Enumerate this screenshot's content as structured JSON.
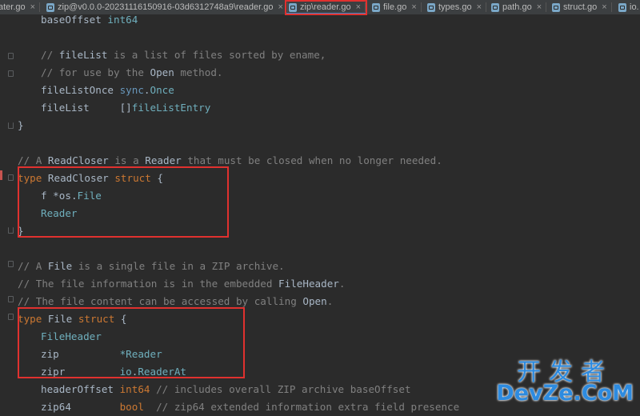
{
  "tabs": [
    {
      "label": "ater.go",
      "icon": "go-file-icon",
      "active": false
    },
    {
      "label": "zip@v0.0.0-20231116150916-03d6312748a9\\reader.go",
      "icon": "go-file-icon",
      "active": false
    },
    {
      "label": "zip\\reader.go",
      "icon": "go-file-icon",
      "active": true
    },
    {
      "label": "file.go",
      "icon": "go-file-icon",
      "active": false
    },
    {
      "label": "types.go",
      "icon": "go-file-icon",
      "active": false
    },
    {
      "label": "path.go",
      "icon": "go-file-icon",
      "active": false
    },
    {
      "label": "struct.go",
      "icon": "go-file-icon",
      "active": false
    },
    {
      "label": "io.",
      "icon": "go-file-icon",
      "active": false
    }
  ],
  "close_glyph": "×",
  "code": {
    "l1": {
      "a": "baseOffset",
      "b": "int64"
    },
    "l3": {
      "a": "// ",
      "b": "fileList",
      "c": " is a list of files sorted by ename,"
    },
    "l4": {
      "a": "// for use by the ",
      "b": "Open",
      "c": " method."
    },
    "l5": {
      "a": "fileListOnce ",
      "b": "sync",
      "c": ".",
      "d": "Once"
    },
    "l6": {
      "a": "fileList     ",
      "b": "[]",
      "c": "fileListEntry"
    },
    "l7": {
      "a": "}"
    },
    "l9": {
      "a": "// A ",
      "b": "ReadCloser",
      "c": " is a ",
      "d": "Reader",
      "e": " that must be closed when no longer needed."
    },
    "l10": {
      "a": "type",
      "b": " ReadCloser ",
      "c": "struct",
      "d": " {"
    },
    "l11": {
      "a": "f ",
      "b": "*",
      "c": "os",
      "d": ".",
      "e": "File"
    },
    "l12": {
      "a": "Reader"
    },
    "l13": {
      "a": "}"
    },
    "l15": {
      "a": "// A ",
      "b": "File",
      "c": " is a single file in a ZIP archive."
    },
    "l16": {
      "a": "// The file information is in the embedded ",
      "b": "FileHeader",
      "c": "."
    },
    "l17": {
      "a": "// The file content can be accessed by calling ",
      "b": "Open",
      "c": "."
    },
    "l18": {
      "a": "type",
      "b": " File ",
      "c": "struct",
      "d": " {"
    },
    "l19": {
      "a": "FileHeader"
    },
    "l20": {
      "a": "zip          ",
      "b": "*Reader"
    },
    "l21": {
      "a": "zipr         ",
      "b": "io",
      "c": ".",
      "d": "ReaderAt"
    },
    "l22": {
      "a": "headerOffset ",
      "b": "int64",
      "c": " // includes overall ZIP archive baseOffset"
    },
    "l23": {
      "a": "zip64        ",
      "b": "bool",
      "c": "  // zip64 extended information extra field presence"
    }
  },
  "watermark": {
    "cn": "开发者",
    "en": "DevZe.CoM"
  },
  "colors": {
    "highlight": "#e0312f",
    "keyword": "#cc7832",
    "type": "#6897bb",
    "comment": "#808080"
  }
}
